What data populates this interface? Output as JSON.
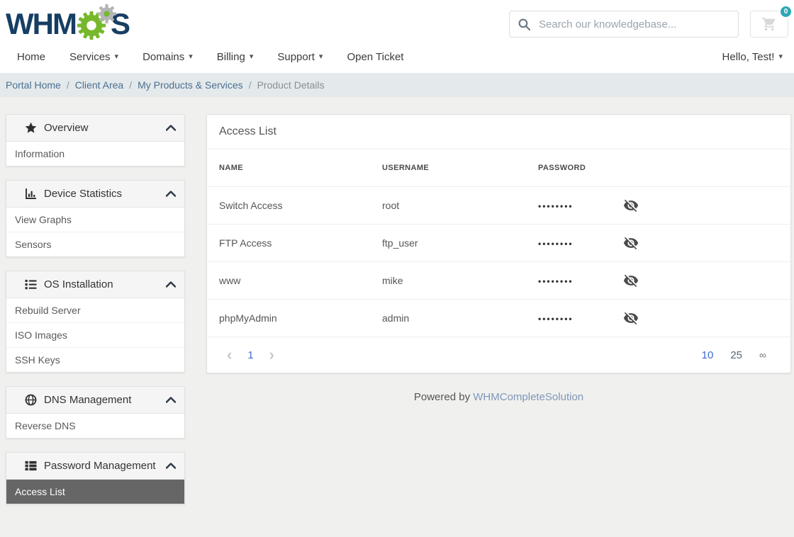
{
  "colors": {
    "logo_navy": "#173e63",
    "logo_green": "#76b82a",
    "gear_gray": "#b5b5b5",
    "badge_teal": "#2da7b4",
    "link_blue": "#3d6dcc",
    "breadcrumb_link": "#4a708f",
    "active_item_bg": "#666666",
    "footer_link": "#7e97b8"
  },
  "header": {
    "logo_text_1": "WHM",
    "logo_text_2": "S",
    "search_placeholder": "Search our knowledgebase...",
    "cart_count": "0"
  },
  "nav": {
    "items": [
      {
        "label": "Home",
        "dropdown": false
      },
      {
        "label": "Services",
        "dropdown": true
      },
      {
        "label": "Domains",
        "dropdown": true
      },
      {
        "label": "Billing",
        "dropdown": true
      },
      {
        "label": "Support",
        "dropdown": true
      },
      {
        "label": "Open Ticket",
        "dropdown": false
      }
    ],
    "user_label": "Hello, Test!"
  },
  "icons": {
    "caret": "▾",
    "prev": "‹",
    "next": "›",
    "infinity": "∞"
  },
  "breadcrumb": {
    "separator": "/",
    "items": [
      {
        "label": "Portal Home"
      },
      {
        "label": "Client Area"
      },
      {
        "label": "My Products & Services"
      }
    ],
    "current": "Product Details"
  },
  "sidebar": {
    "panels": [
      {
        "title": "Overview",
        "icon": "star-icon",
        "items": [
          {
            "label": "Information",
            "active": false
          }
        ]
      },
      {
        "title": "Device Statistics",
        "icon": "bar-chart-icon",
        "items": [
          {
            "label": "View Graphs",
            "active": false
          },
          {
            "label": "Sensors",
            "active": false
          }
        ]
      },
      {
        "title": "OS Installation",
        "icon": "list-icon",
        "items": [
          {
            "label": "Rebuild Server",
            "active": false
          },
          {
            "label": "ISO Images",
            "active": false
          },
          {
            "label": "SSH Keys",
            "active": false
          }
        ]
      },
      {
        "title": "DNS Management",
        "icon": "globe-icon",
        "items": [
          {
            "label": "Reverse DNS",
            "active": false
          }
        ]
      },
      {
        "title": "Password Management",
        "icon": "table-list-icon",
        "items": [
          {
            "label": "Access List",
            "active": true
          }
        ]
      }
    ]
  },
  "main": {
    "title": "Access List",
    "table": {
      "headers": [
        "NAME",
        "USERNAME",
        "PASSWORD"
      ],
      "rows": [
        {
          "name": "Switch Access",
          "username": "root",
          "password_mask": "••••••••"
        },
        {
          "name": "FTP Access",
          "username": "ftp_user",
          "password_mask": "••••••••"
        },
        {
          "name": "www",
          "username": "mike",
          "password_mask": "••••••••"
        },
        {
          "name": "phpMyAdmin",
          "username": "admin",
          "password_mask": "••••••••"
        }
      ]
    },
    "pagination": {
      "current_page": "1",
      "page_sizes": [
        "10",
        "25"
      ],
      "active_size": "10"
    }
  },
  "footer": {
    "prefix": "Powered by",
    "link_text": "WHMCompleteSolution"
  }
}
